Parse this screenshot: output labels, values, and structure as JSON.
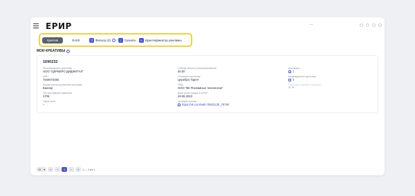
{
  "app": {
    "logo": "ЕРИР"
  },
  "toolbar": {
    "tabs": [
      {
        "label": "Креатив"
      },
      {
        "label": "ФАЕЕ"
      }
    ],
    "filter_label": "Фильтр (2)",
    "download_label": "Скачать",
    "identifier_label": "Идентификатор рекламы"
  },
  "section": {
    "title": "МОИ КРЕАТИВЫ",
    "info": "i"
  },
  "creative": {
    "id": "1690232",
    "advertiser_label": "Рекламодатель креатива",
    "advertiser_value": "ООО \"ЦЕРБЕРО ДИДЖИТАЛ\"",
    "inn_label": "ИНН",
    "inn_value": "7840073350",
    "form_label": "Форма распространения рекламы",
    "form_value": "Баннер",
    "campaign_label": "Тип рекламной кампании",
    "campaign_value": "CPM",
    "targeting_label": "Таргетинги",
    "targeting_value": "–",
    "okved_label": "ОКВЭД объекта рекламирования",
    "okved_value": "00.00",
    "description_label": "Описание креатива",
    "description_value": "Церебро Таргет",
    "ord_label": "ОРД",
    "ord_value": "ООО \"ВК Рекламные технологии\"",
    "date_label": "Дата регистрации в ЕРИР",
    "date_value": "28.08.2023",
    "link_label": "Целевая ссылка",
    "link_value": "https://vk.com/wall-75902130_78790",
    "contracts_label": "Договоры",
    "contracts_value": "1",
    "media_label": "Медиаданные креатива",
    "media_value": "3",
    "extra_label": "Текстовые данные креатива"
  },
  "pager": {
    "page_size": "10",
    "pages": [
      "‹",
      "«",
      "1",
      "›",
      "»"
    ],
    "current": "1",
    "range": "1 — 1 из 1"
  }
}
